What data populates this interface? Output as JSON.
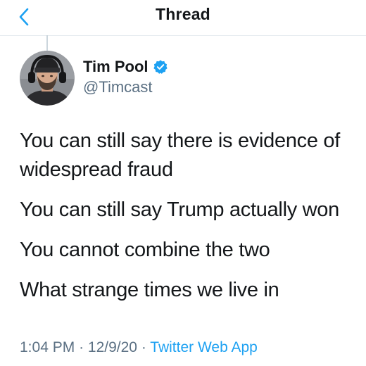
{
  "header": {
    "title": "Thread",
    "back_icon": "chevron-left-icon"
  },
  "author": {
    "display_name": "Tim Pool",
    "handle": "@Timcast",
    "verified": true,
    "verified_icon": "verified-badge-icon"
  },
  "tweet": {
    "paragraphs": [
      "You can still say there is evidence of widespread fraud",
      "You can still say Trump actually won",
      "You cannot combine the two",
      "What strange times we live in"
    ],
    "time": "1:04 PM",
    "date": "12/9/20",
    "separator": "·",
    "source": "Twitter Web App"
  },
  "colors": {
    "accent": "#1da1f2",
    "secondary_text": "#5b7083",
    "primary_text": "#14171a"
  }
}
